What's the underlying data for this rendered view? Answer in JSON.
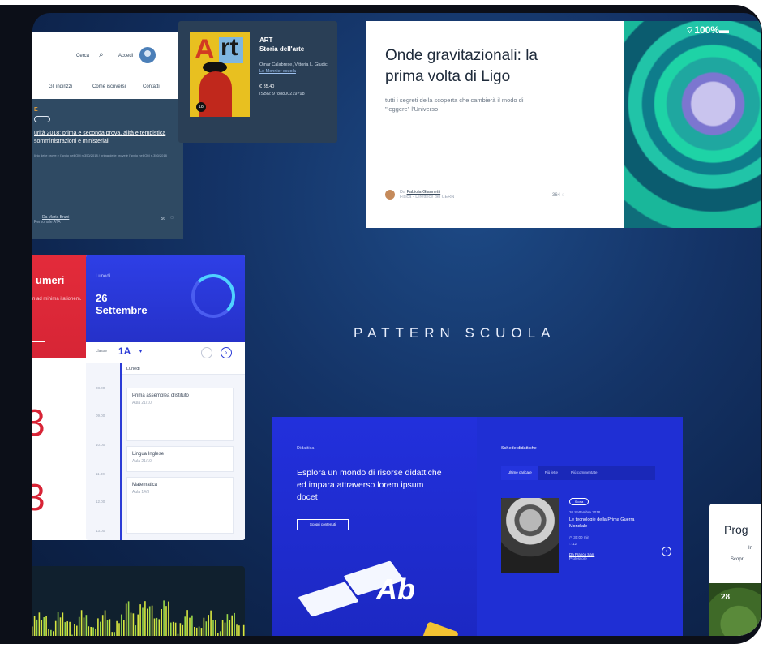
{
  "status": {
    "battery": "100%"
  },
  "header_card": {
    "search": "Cerca",
    "login": "Accedi",
    "nav": [
      "Gli indirizzi",
      "Come iscriversi",
      "Contatti"
    ],
    "category": "E",
    "title": "urità 2018: prima e seconda prova, alità e tempistica somministrazioni e ministeriali",
    "desc": "lizio delle prove è l'avvio nell'OM n.350/2018 / prima delle prove è l'avvio nell'OM n.350/2018",
    "author": "Da Maria Bruni",
    "role": "Personale ATA",
    "count": "56"
  },
  "book_card": {
    "badge": "18",
    "type": "ART",
    "title": "Storia dell'arte",
    "authors": "Omar Calabrese, Vittoria L. Giudici",
    "publisher": "Le Monnier scuola",
    "price": "€ 35,40",
    "isbn": "ISBN: 9788800219798",
    "cover_letters": [
      "A",
      "rt"
    ]
  },
  "article_card": {
    "title": "Onde gravitazionali: la prima volta di Ligo",
    "subtitle": "tutti i segreti della scoperta che cambierà il modo di \"leggere\" l'Universo",
    "author_prefix": "Da",
    "author": "Fabiola Giannetti",
    "author_role": "Fisica - Direttrice del CERN",
    "count": "364"
  },
  "numbers_card": {
    "title": "umeri",
    "text": "n ad minima itationem.",
    "big1": "3",
    "big2": "3"
  },
  "calendar_card": {
    "weekday": "Lunedì",
    "date": "26 Settembre",
    "class_label": "classe",
    "class_value": "1A",
    "column_day": "Lunedì",
    "times": [
      "08.00",
      "09.00",
      "10.00",
      "11.00",
      "12.00",
      "13.00"
    ],
    "events": [
      {
        "title": "Prima assemblea d'istituto",
        "room": "Aula 21/10"
      },
      {
        "title": "Lingua Inglese",
        "room": "Aula 21/10"
      },
      {
        "title": "Matematica",
        "room": "Aula 14/3"
      }
    ]
  },
  "pattern_title": "PATTERN SCUOLA",
  "didattica_card": {
    "kicker": "Didattica",
    "heading": "Esplora un mondo di risorse didattiche ed impara attraverso lorem ipsum docet",
    "button": "Scopri contenuti",
    "schede_title": "Schede didattiche",
    "tabs": [
      "Ultime caricate",
      "Più lette",
      "Più commentate"
    ],
    "item": {
      "tag": "Storia",
      "date": "20 Settembre 2018",
      "title": "Le tecnologie della Prima Guerra Mondiale",
      "time": "30:00 min",
      "comments": "12",
      "author": "Franco Sani",
      "role": "Professore"
    }
  },
  "prog_card": {
    "title": "Prog",
    "line1": "In",
    "line2": "Scopri",
    "number": "28"
  },
  "colors": {
    "accent_blue": "#1f2fd4",
    "red": "#d82436",
    "teal": "#1ed3a6"
  }
}
